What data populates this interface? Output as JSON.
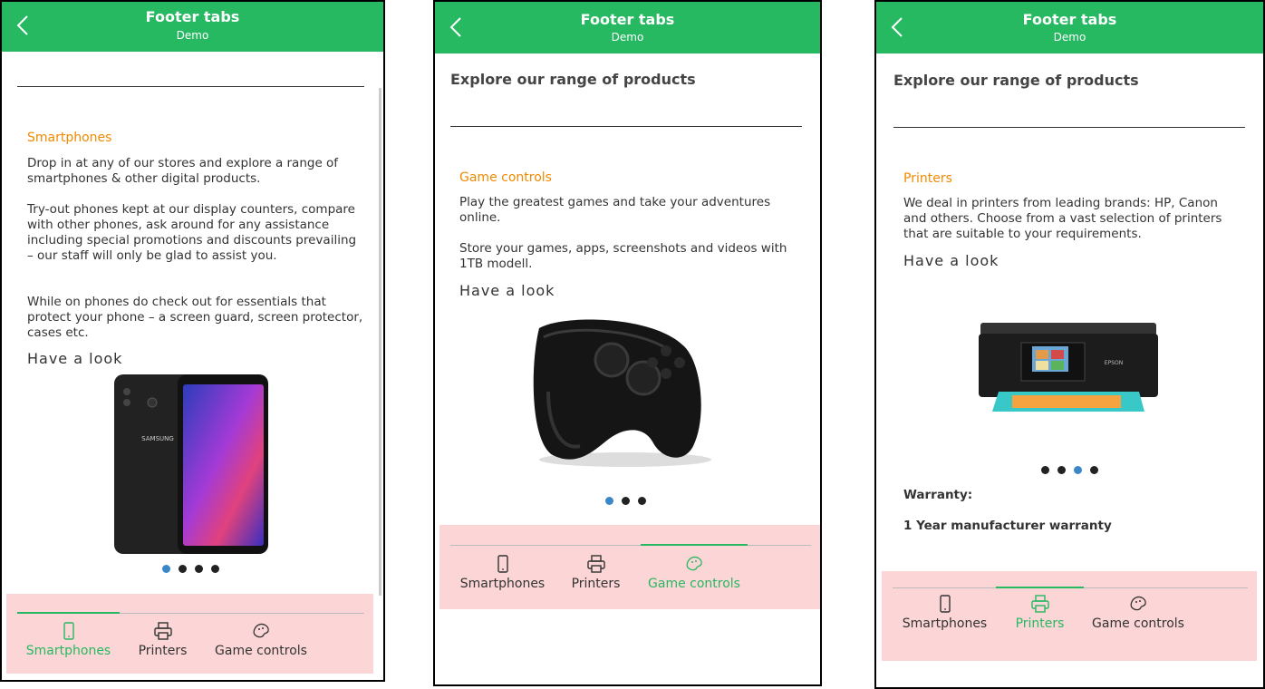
{
  "screens": [
    {
      "header": {
        "title": "Footer tabs",
        "subtitle": "Demo"
      },
      "category": "Smartphones",
      "paragraphs": [
        "Drop in at any of our stores and explore a range of smartphones & other digital products.",
        "Try-out phones kept at our display counters, compare with other phones, ask around for any assistance including special promotions and discounts prevailing – our staff will only be glad to assist you.",
        "While on phones do check out for essentials that protect your phone – a screen guard, screen protector, cases etc."
      ],
      "have_look": "Have a look",
      "carousel": {
        "count": 4,
        "active": 1
      },
      "tabs": [
        {
          "label": "Smartphones",
          "icon": "smartphone-icon",
          "active": true
        },
        {
          "label": "Printers",
          "icon": "printer-icon",
          "active": false
        },
        {
          "label": "Game controls",
          "icon": "gamepad-icon",
          "active": false
        }
      ],
      "image": "samsung-phone-image",
      "image_text": "SAMSUNG"
    },
    {
      "header": {
        "title": "Footer tabs",
        "subtitle": "Demo"
      },
      "section_title": "Explore our range of products",
      "category": "Game controls",
      "paragraphs": [
        "Play the greatest games and take your adventures online.",
        "Store your games, apps, screenshots and videos with 1TB modell."
      ],
      "have_look": "Have a look",
      "carousel": {
        "count": 3,
        "active": 1
      },
      "tabs": [
        {
          "label": "Smartphones",
          "icon": "smartphone-icon",
          "active": false
        },
        {
          "label": "Printers",
          "icon": "printer-icon",
          "active": false
        },
        {
          "label": "Game controls",
          "icon": "gamepad-icon",
          "active": true
        }
      ],
      "image": "game-controller-image"
    },
    {
      "header": {
        "title": "Footer tabs",
        "subtitle": "Demo"
      },
      "section_title": "Explore our range of products",
      "category": "Printers",
      "paragraphs": [
        "We deal in printers from leading brands: HP, Canon and others. Choose from a vast selection of printers that are suitable to your requirements."
      ],
      "have_look": "Have a look",
      "carousel": {
        "count": 4,
        "active": 3
      },
      "warranty_label": "Warranty:",
      "warranty_value": "1 Year manufacturer warranty",
      "tabs": [
        {
          "label": "Smartphones",
          "icon": "smartphone-icon",
          "active": false
        },
        {
          "label": "Printers",
          "icon": "printer-icon",
          "active": true
        },
        {
          "label": "Game controls",
          "icon": "gamepad-icon",
          "active": false
        }
      ],
      "image": "printer-image",
      "image_text": "EPSON"
    }
  ],
  "colors": {
    "header": "#27b862",
    "accent_orange": "#f08a00",
    "footer_bg": "#fcd5d6",
    "active_dot": "#3b87c8"
  }
}
